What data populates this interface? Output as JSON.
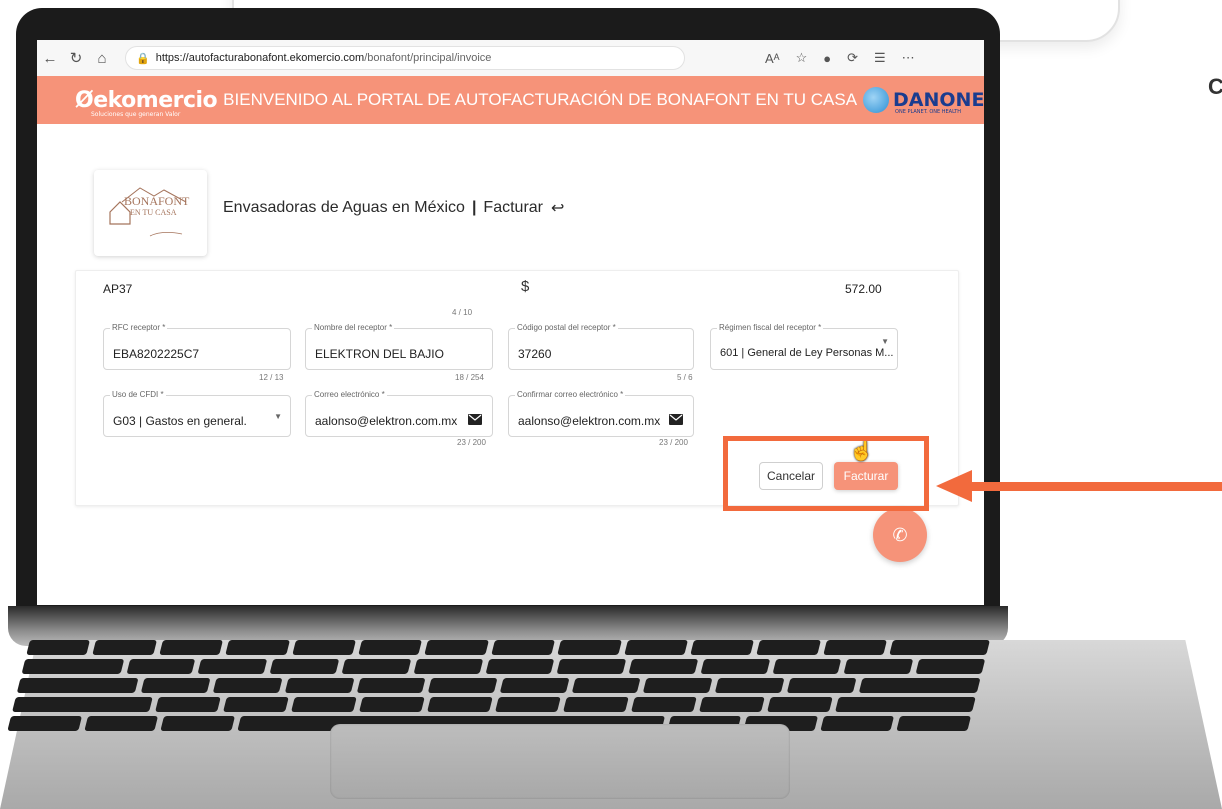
{
  "background": {
    "corner_letter": "C"
  },
  "browser": {
    "url_host": "https://autofacturabonafont.ekomercio.com",
    "url_path": "/bonafont/principal/invoice",
    "icons": [
      "back-arrow-icon",
      "refresh-icon",
      "home-icon",
      "lock-icon",
      "read-aloud-icon",
      "favorite-star-icon",
      "profile-icon",
      "extensions-icon",
      "favorites-icon",
      "more-icon"
    ]
  },
  "banner": {
    "logo": "ekomercio",
    "logo_tagline": "Soluciones que generan Valor",
    "title": "BIENVENIDO AL PORTAL DE AUTOFACTURACIÓN DE BONAFONT EN TU CASA",
    "partner_logo": "DANONE",
    "partner_tagline": "ONE PLANET. ONE HEALTH",
    "color": "#f69379"
  },
  "brand": {
    "name": "BONAFONT",
    "sub": "EN TU CASA"
  },
  "page": {
    "company": "Envasadoras de Aguas en México",
    "separator": "|",
    "action": "Facturar"
  },
  "form": {
    "ticket": {
      "value": "AP37",
      "counter": "4 / 10"
    },
    "amount": {
      "currency": "$",
      "value": "572.00"
    },
    "rfc": {
      "label": "RFC receptor *",
      "value": "EBA8202225C7",
      "counter": "12 / 13"
    },
    "nombre": {
      "label": "Nombre del receptor *",
      "value": "ELEKTRON DEL BAJIO",
      "counter": "18 / 254"
    },
    "cp": {
      "label": "Código postal del receptor *",
      "value": "37260",
      "counter": "5 / 6"
    },
    "regimen": {
      "label": "Régimen fiscal del receptor *",
      "value": "601 | General de Ley Personas M..."
    },
    "uso": {
      "label": "Uso de CFDI *",
      "value": "G03 | Gastos en general."
    },
    "correo": {
      "label": "Correo electrónico *",
      "value": "aalonso@elektron.com.mx",
      "counter": "23 / 200"
    },
    "confirmar": {
      "label": "Confirmar correo electrónico *",
      "value": "aalonso@elektron.com.mx",
      "counter": "23 / 200"
    }
  },
  "buttons": {
    "cancel": "Cancelar",
    "submit": "Facturar"
  },
  "annotation": {
    "color": "#f26a3d"
  }
}
